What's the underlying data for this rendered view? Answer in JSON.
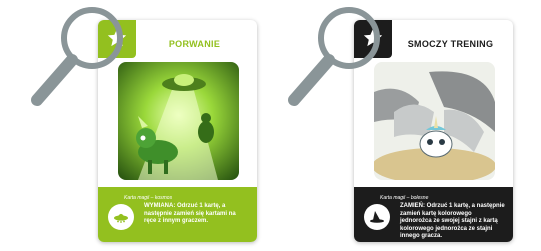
{
  "cards": [
    {
      "title": "PORWANIE",
      "type_line": "Karta magii – kosmos",
      "description": "WYMIANA: Odrzuć 1 kartę, a następnie zamień się kartami na ręce z innym graczem.",
      "accent": "#93c01f",
      "icon": "star-icon",
      "badge_icon": "ufo-icon"
    },
    {
      "title": "SMOCZY TRENING",
      "type_line": "Karta magii – bolesne",
      "description": "ZAMIEŃ: Odrzuć 1 kartę, a następnie zamień kartę kolorowego jednorożca ze swojej stajni z kartą kolorowego jednorożca ze stajni innego gracza.",
      "accent": "#1c1c1c",
      "icon": "star-icon",
      "badge_icon": "witch-hat-icon"
    }
  ],
  "colors": {
    "magnifier": "#8a9598"
  }
}
